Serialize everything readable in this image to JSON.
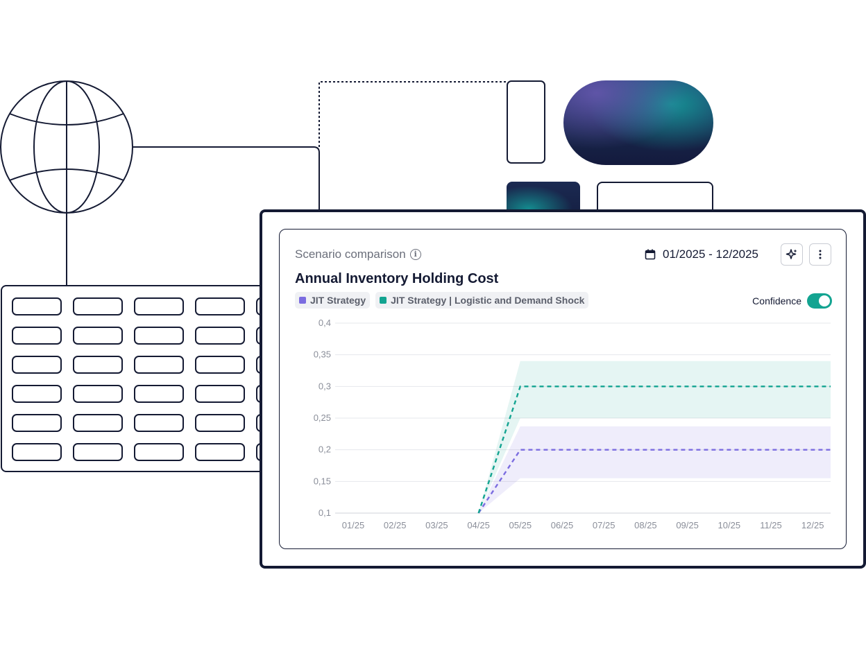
{
  "card": {
    "subtitle": "Scenario comparison",
    "title": "Annual Inventory Holding Cost",
    "date_range": "01/2025 - 12/2025",
    "confidence_label": "Confidence",
    "confidence_enabled": true
  },
  "icons": {
    "info": "info-icon",
    "calendar": "calendar-icon",
    "ai": "sparkle-icon",
    "more": "more-vertical-icon"
  },
  "colors": {
    "jit": "#7b6ce0",
    "shock": "#13a491",
    "dark": "#141a33",
    "toggle_on": "#13a491"
  },
  "chart_data": {
    "type": "line",
    "x": [
      "01/25",
      "02/25",
      "03/25",
      "04/25",
      "05/25",
      "06/25",
      "07/25",
      "08/25",
      "09/25",
      "10/25",
      "11/25",
      "12/25"
    ],
    "y_ticks": [
      "0,1",
      "0,15",
      "0,2",
      "0,25",
      "0,3",
      "0,35",
      "0,4"
    ],
    "ylim": [
      0.1,
      0.4
    ],
    "grid": true,
    "legend_position": "top-left",
    "series": [
      {
        "name": "JIT Strategy",
        "color": "#7b6ce0",
        "style": "dashed",
        "points": [
          [
            "04/25",
            0.1
          ],
          [
            "05/25",
            0.2
          ],
          [
            "12/25",
            0.2
          ]
        ],
        "band_lower": [
          [
            "04/25",
            0.1
          ],
          [
            "05/25",
            0.155
          ],
          [
            "12/25",
            0.155
          ]
        ],
        "band_upper": [
          [
            "04/25",
            0.1
          ],
          [
            "05/25",
            0.237
          ],
          [
            "12/25",
            0.237
          ]
        ]
      },
      {
        "name": "JIT Strategy | Logistic and Demand Shock",
        "color": "#13a491",
        "style": "dashed",
        "points": [
          [
            "04/25",
            0.1
          ],
          [
            "05/25",
            0.3
          ],
          [
            "12/25",
            0.3
          ]
        ],
        "band_lower": [
          [
            "04/25",
            0.1
          ],
          [
            "05/25",
            0.25
          ],
          [
            "12/25",
            0.25
          ]
        ],
        "band_upper": [
          [
            "04/25",
            0.1
          ],
          [
            "05/25",
            0.34
          ],
          [
            "12/25",
            0.34
          ]
        ]
      }
    ]
  }
}
